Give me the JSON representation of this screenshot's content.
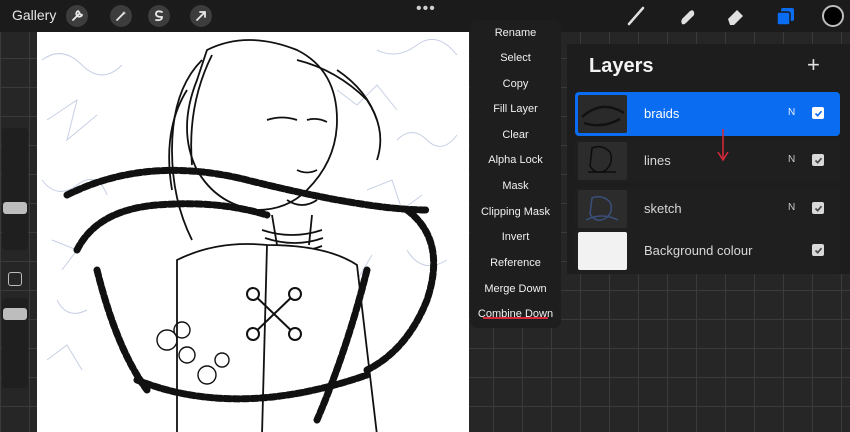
{
  "topbar": {
    "gallery_label": "Gallery",
    "tools_left": [
      "wrench-icon",
      "magic-wand-icon",
      "selection-icon",
      "transform-arrow-icon"
    ],
    "more_label": "•••",
    "tools_right": [
      "brush-icon",
      "smudge-icon",
      "eraser-icon",
      "layers-icon"
    ],
    "current_color": "#000000"
  },
  "layer_menu": {
    "items": [
      "Rename",
      "Select",
      "Copy",
      "Fill Layer",
      "Clear",
      "Alpha Lock",
      "Mask",
      "Clipping Mask",
      "Invert",
      "Reference",
      "Merge Down",
      "Combine Down"
    ],
    "highlighted_item": "Merge Down"
  },
  "layers_panel": {
    "title": "Layers",
    "add_label": "+",
    "layers": [
      {
        "name": "braids",
        "blend": "N",
        "visible": true,
        "active": true
      },
      {
        "name": "lines",
        "blend": "N",
        "visible": true,
        "active": false
      },
      {
        "name": "sketch",
        "blend": "N",
        "visible": true,
        "active": false
      },
      {
        "name": "Background colour",
        "blend": "",
        "visible": true,
        "active": false
      }
    ]
  },
  "colors": {
    "accent": "#0a6cf0",
    "annotation": "#d2283a"
  }
}
